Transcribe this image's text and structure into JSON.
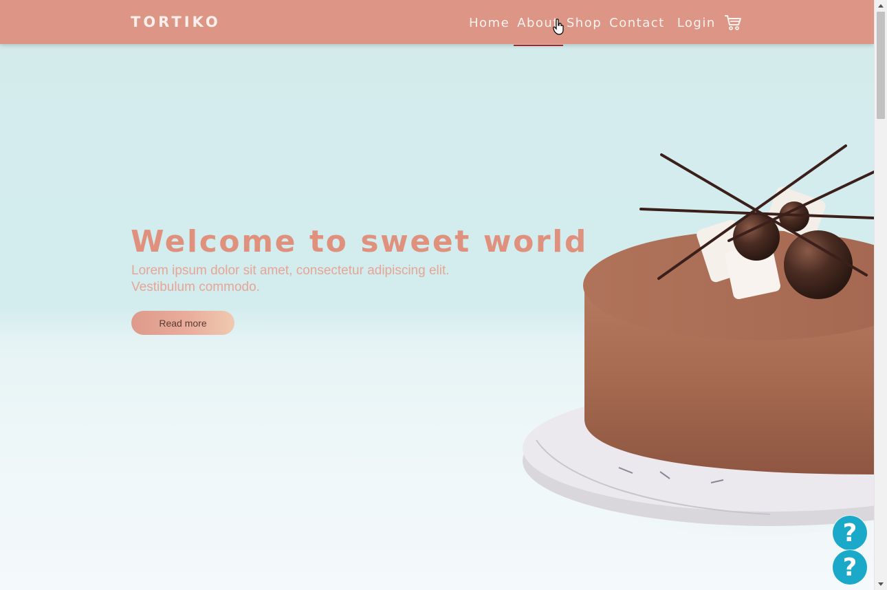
{
  "header": {
    "brand": "TORTIKO",
    "nav": [
      {
        "label": "Home"
      },
      {
        "label": "About",
        "active": true
      },
      {
        "label": "Shop"
      },
      {
        "label": "Contact"
      },
      {
        "label": "Login"
      }
    ],
    "cart_icon": "shopping-cart-icon"
  },
  "hero": {
    "title": "Welcome to sweet world",
    "subtitle": "Lorem ipsum dolor sit amet, consectetur adipiscing elit. Vestibulum commodo.",
    "button_label": "Read more",
    "image": "chocolate-mousse-cake"
  },
  "help": {
    "symbol": "?",
    "icon": "help-question-icon"
  },
  "colors": {
    "header_bg": "#dd9686",
    "accent": "#e0917d",
    "active_underline": "#b01f1f",
    "help_bg": "#1aa9c8",
    "hero_bg": "#d4ebec"
  }
}
